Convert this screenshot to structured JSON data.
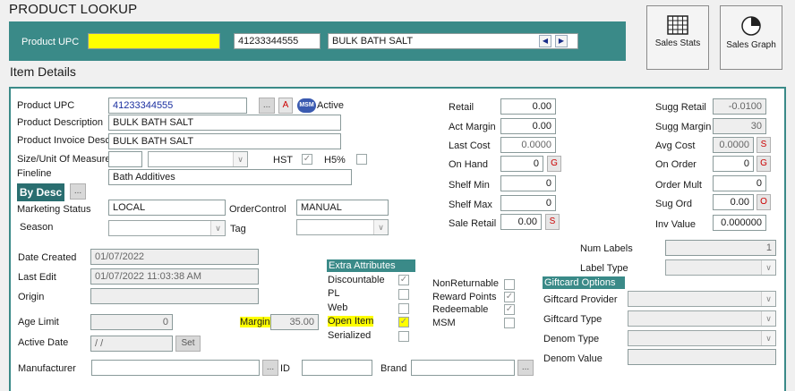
{
  "header": {
    "title": "PRODUCT LOOKUP"
  },
  "lookup": {
    "label": "Product UPC",
    "upc_input": "",
    "upc_value": "41233344555",
    "desc_value": "BULK BATH SALT",
    "prev_icon": "◀",
    "next_icon": "▶"
  },
  "tiles": {
    "sales_stats": "Sales Stats",
    "sales_graph": "Sales Graph"
  },
  "section": {
    "title": "Item Details"
  },
  "labels": {
    "product_upc": "Product UPC",
    "product_description": "Product Description",
    "product_invoice_desc": "Product Invoice Desc",
    "size_uom": "Size/Unit Of Measure",
    "hst": "HST",
    "h5": "H5%",
    "fineline": "Fineline",
    "marketing_status": "Marketing Status",
    "order_control": "OrderControl",
    "season": "Season",
    "tag": "Tag",
    "date_created": "Date Created",
    "last_edit": "Last Edit",
    "origin": "Origin",
    "age_limit": "Age Limit",
    "margin": "Margin",
    "active_date": "Active Date",
    "manufacturer": "Manufacturer",
    "id": "ID",
    "brand": "Brand",
    "retail": "Retail",
    "act_margin": "Act Margin",
    "last_cost": "Last Cost",
    "on_hand": "On Hand",
    "shelf_min": "Shelf Min",
    "shelf_max": "Shelf Max",
    "sale_retail": "Sale Retail",
    "sugg_retail": "Sugg Retail",
    "sugg_margin": "Sugg Margin",
    "avg_cost": "Avg Cost",
    "on_order": "On Order",
    "order_mult": "Order Mult",
    "sug_ord": "Sug Ord",
    "inv_value": "Inv Value",
    "num_labels": "Num Labels",
    "label_type": "Label Type",
    "giftcard_provider": "Giftcard Provider",
    "giftcard_type": "Giftcard Type",
    "denom_type": "Denom Type",
    "denom_value": "Denom Value"
  },
  "values": {
    "product_upc": "41233344555",
    "active": "Active",
    "product_description": "BULK BATH SALT",
    "product_invoice_desc": "BULK BATH SALT",
    "fineline": "Bath Additives",
    "marketing_status": "LOCAL",
    "order_control": "MANUAL",
    "date_created": "01/07/2022",
    "last_edit": "01/07/2022 11:03:38 AM",
    "age_limit": "0",
    "margin": "35.00",
    "active_date": " / /",
    "retail": "0.00",
    "act_margin": "0.00",
    "last_cost": "0.0000",
    "on_hand": "0",
    "shelf_min": "0",
    "shelf_max": "0",
    "sale_retail": "0.00",
    "sugg_retail": "-0.0100",
    "sugg_margin": "30",
    "avg_cost": "0.0000",
    "on_order": "0",
    "order_mult": "0",
    "sug_ord": "0.00",
    "inv_value": "0.000000",
    "num_labels": "1"
  },
  "buttons": {
    "ellipsis": "...",
    "a": "A",
    "msm": "MSM",
    "by_desc": "By Desc",
    "s": "S",
    "g": "G",
    "o": "O",
    "set": "Set"
  },
  "extra_attributes": {
    "title": "Extra Attributes",
    "items": [
      "Discountable",
      "PL",
      "Web",
      "Open Item",
      "Serialized"
    ]
  },
  "flags": {
    "items": [
      "NonReturnable",
      "Reward Points",
      "Redeemable",
      "MSM"
    ]
  },
  "giftcard": {
    "title": "Giftcard Options"
  },
  "icons": {
    "check": "✓",
    "dropdown": "∨"
  },
  "colors": {
    "teal": "#3a8a88",
    "highlight": "#ffff00",
    "red_button_text": "#cc0000"
  }
}
